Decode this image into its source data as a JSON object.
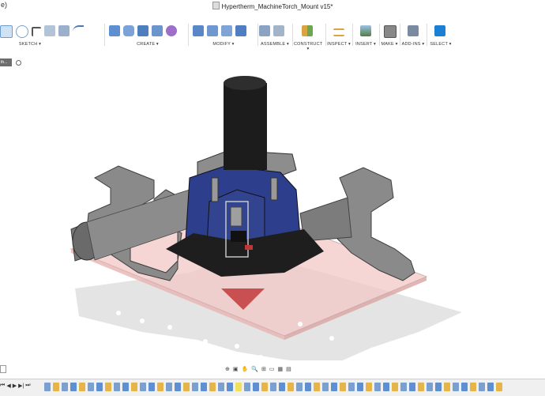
{
  "window": {
    "left_fragment": "e)",
    "title": "Hypertherm_MachineTorch_Mount v15*"
  },
  "toolbar": {
    "groups": [
      {
        "label": "SKETCH ▾"
      },
      {
        "label": "CREATE ▾"
      },
      {
        "label": "MODIFY ▾"
      },
      {
        "label": "ASSEMBLE ▾"
      },
      {
        "label": "CONSTRUCT ▾"
      },
      {
        "label": "INSPECT ▾"
      },
      {
        "label": "INSERT ▾"
      },
      {
        "label": "MAKE ▾"
      },
      {
        "label": "ADD-INS ▾"
      },
      {
        "label": "SELECT ▾"
      }
    ]
  },
  "browser": {
    "row_label": "th...",
    "sub_label": "",
    "visibility_icon": "eye-icon"
  },
  "colors": {
    "body_blue": "#2d3f8c",
    "gray": "#7d7d7d",
    "dark": "#1e1e1e",
    "plate_pink": "#f3c9c6",
    "nozzle_red": "#c85050",
    "select_blue": "#1b7fd4"
  }
}
